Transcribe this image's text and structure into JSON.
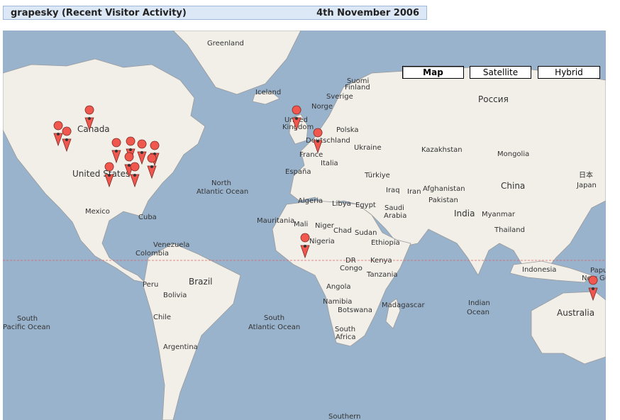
{
  "header": {
    "title": "grapesky (Recent Visitor Activity)",
    "date": "4th November 2006"
  },
  "map_types": [
    {
      "label": "Map",
      "active": true
    },
    {
      "label": "Satellite",
      "active": false
    },
    {
      "label": "Hybrid",
      "active": false
    }
  ],
  "labels": {
    "greenland": "Greenland",
    "iceland": "Iceland",
    "suomi": "Suomi",
    "finland": "Finland",
    "sverige": "Sverige",
    "norge": "Norge",
    "russia": "Россия",
    "canada": "Canada",
    "united_kingdom_a": "United",
    "united_kingdom_b": "Kingdom",
    "polska": "Polska",
    "deutschland": "Deutschland",
    "ukraine": "Ukraine",
    "kazakhstan": "Kazakhstan",
    "mongolia": "Mongolia",
    "france": "France",
    "italia": "Italia",
    "espana": "España",
    "turkiye": "Türkiye",
    "japan_jp": "日本",
    "japan": "Japan",
    "united_states": "United States",
    "north_atlantic_a": "North",
    "north_atlantic_b": "Atlantic Ocean",
    "iraq": "Iraq",
    "iran": "Iran",
    "afghanistan": "Afghanistan",
    "china": "China",
    "algeria": "Algeria",
    "libya": "Libya",
    "egypt": "Egypt",
    "saudi_a": "Saudi",
    "saudi_b": "Arabia",
    "pakistan": "Pakistan",
    "mexico": "Mexico",
    "cuba": "Cuba",
    "india": "India",
    "myanmar": "Myanmar",
    "mauritania": "Mauritania",
    "mali": "Mali",
    "niger": "Niger",
    "chad": "Chad",
    "sudan": "Sudan",
    "thailand": "Thailand",
    "venezuela": "Venezuela",
    "colombia": "Colombia",
    "nigeria": "Nigeria",
    "ethiopia": "Ethiopia",
    "dr": "DR",
    "congo": "Congo",
    "kenya": "Kenya",
    "indonesia": "Indonesia",
    "papua": "Papu",
    "new_guinea": "New Gu",
    "peru": "Peru",
    "brazil": "Brazil",
    "tanzania": "Tanzania",
    "angola": "Angola",
    "bolivia": "Bolivia",
    "namibia": "Namibia",
    "botswana": "Botswana",
    "madagascar": "Madagascar",
    "indian_a": "Indian",
    "indian_b": "Ocean",
    "south_pacific_a": "South",
    "south_pacific_b": "Pacific Ocean",
    "chile": "Chile",
    "south_atlantic_a": "South",
    "south_atlantic_b": "Atlantic Ocean",
    "south_africa_a": "South",
    "south_africa_b": "Africa",
    "australia": "Australia",
    "argentina": "Argentina",
    "southern": "Southern"
  },
  "colors": {
    "water": "#99b3cc",
    "land": "#f2efe9",
    "border": "#9a9a9a",
    "marker": "#f0584f",
    "equator": "#e06060",
    "header_bg": "#dde8f6"
  }
}
